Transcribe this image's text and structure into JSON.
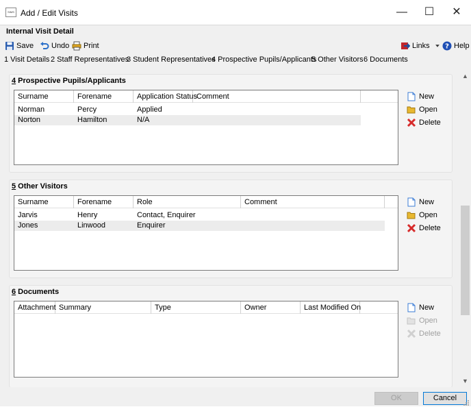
{
  "window": {
    "title": "Add / Edit Visits",
    "icon_text": "SIMS",
    "minimize_label": "—",
    "maximize_label": "☐",
    "close_label": "✕"
  },
  "form": {
    "title": "Internal Visit Detail"
  },
  "toolbar": {
    "save_label": "Save",
    "undo_label": "Undo",
    "print_label": "Print",
    "links_label": "Links",
    "help_label": "Help"
  },
  "nav": {
    "links": [
      "1 Visit Details",
      "2 Staff Representatives",
      "3 Student Representatives",
      "4 Prospective Pupils/Applicants",
      "5 Other Visitors",
      "6 Documents"
    ]
  },
  "sections": {
    "pupils": {
      "number": "4",
      "title": " Prospective Pupils/Applicants",
      "columns": [
        "Surname",
        "Forename",
        "Application Status",
        "Comment"
      ],
      "rows": [
        [
          "Norman",
          "Percy",
          "Applied",
          ""
        ],
        [
          "Norton",
          "Hamilton",
          "N/A",
          ""
        ]
      ],
      "buttons": {
        "new": "New",
        "open": "Open",
        "delete": "Delete"
      }
    },
    "visitors": {
      "number": "5",
      "title": " Other Visitors",
      "columns": [
        "Surname",
        "Forename",
        "Role",
        "Comment"
      ],
      "rows": [
        [
          "Jarvis",
          "Henry",
          "Contact, Enquirer",
          ""
        ],
        [
          "Jones",
          "Linwood",
          "Enquirer",
          ""
        ]
      ],
      "buttons": {
        "new": "New",
        "open": "Open",
        "delete": "Delete"
      }
    },
    "documents": {
      "number": "6",
      "title": " Documents",
      "columns": [
        "Attachment",
        "Summary",
        "Type",
        "Owner",
        "Last Modified On"
      ],
      "rows": [],
      "buttons": {
        "new": "New",
        "open": "Open",
        "delete": "Delete"
      }
    }
  },
  "footer": {
    "ok_label": "OK",
    "cancel_label": "Cancel"
  },
  "colors": {
    "accent": "#0078d7",
    "selected_row": "#ececec",
    "disabled_text": "#a0a0a0"
  }
}
